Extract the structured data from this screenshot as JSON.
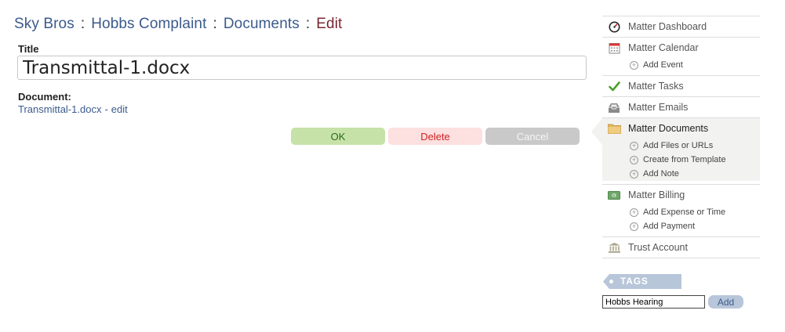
{
  "breadcrumb": {
    "client": "Sky Bros",
    "matter": "Hobbs Complaint",
    "section": "Documents",
    "current": "Edit",
    "separator": ":"
  },
  "form": {
    "title_label": "Title",
    "title_value": "Transmittal-1.docx",
    "document_label": "Document:",
    "document_name": "Transmittal-1.docx",
    "document_dash": "-",
    "document_edit": "edit",
    "ok_label": "OK",
    "delete_label": "Delete",
    "cancel_label": "Cancel"
  },
  "sidebar": {
    "dashboard": "Matter Dashboard",
    "calendar": "Matter Calendar",
    "calendar_add_event": "Add Event",
    "tasks": "Matter Tasks",
    "emails": "Matter Emails",
    "documents": "Matter Documents",
    "documents_add_files": "Add Files or URLs",
    "documents_template": "Create from Template",
    "documents_add_note": "Add Note",
    "billing": "Matter Billing",
    "billing_add_expense": "Add Expense or Time",
    "billing_add_payment": "Add Payment",
    "trust": "Trust Account",
    "active_item": "Matter Documents"
  },
  "tags": {
    "heading": "TAGS",
    "input_value": "Hobbs Hearing",
    "add_label": "Add"
  },
  "colors": {
    "link": "#3b5a8c",
    "current_crumb": "#7a2832",
    "ok_bg": "#c6e2a9",
    "delete_bg": "#fde0e0",
    "cancel_bg": "#c9c9c9",
    "tags_bg": "#b8c6da"
  }
}
